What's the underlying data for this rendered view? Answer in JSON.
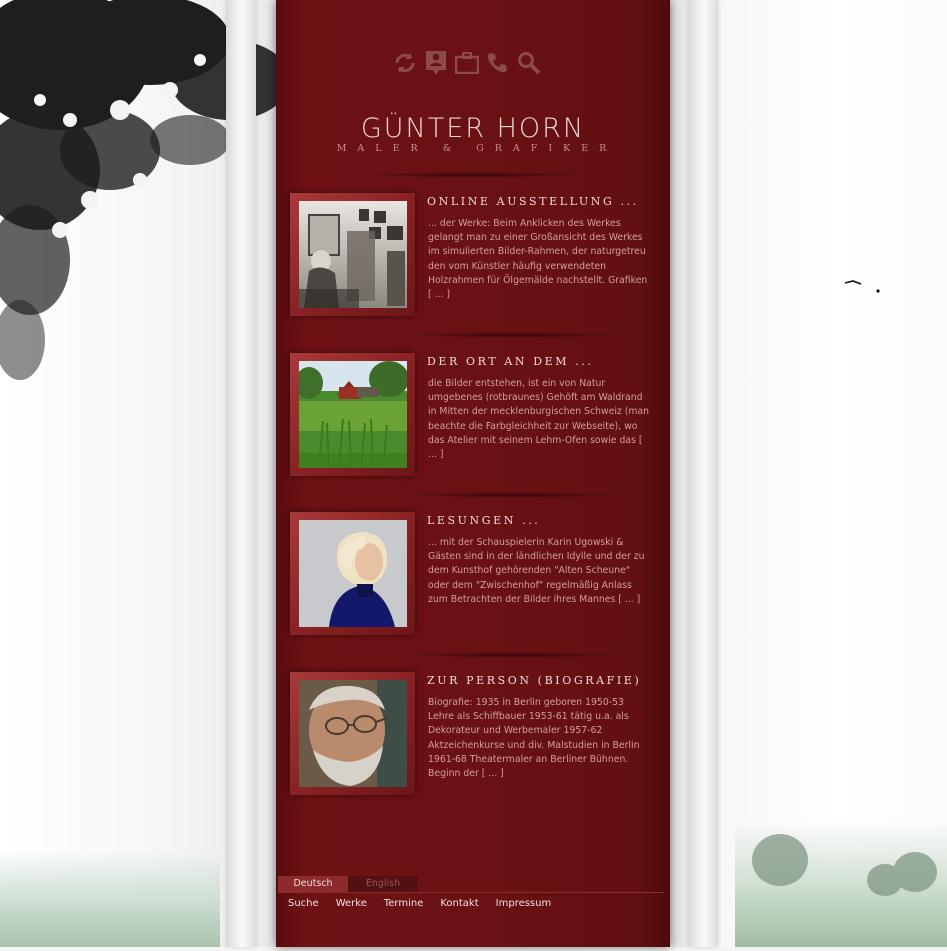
{
  "site": {
    "title": "GÜNTER HORN",
    "subtitle": "MALER & GRAFIKER"
  },
  "toolbar": {
    "icons": [
      "refresh-icon",
      "contact-card-icon",
      "portfolio-icon",
      "phone-icon",
      "search-icon"
    ]
  },
  "articles": [
    {
      "title": "ONLINE AUSSTELLUNG ...",
      "text": "... der Werke: Beim Anklicken des Werkes gelangt man zu einer Großansicht des Werkes im simulierten Bilder-Rahmen, der naturgetreu den vom Künstler häufig verwendeten Holzrahmen für Ölgemälde nachstellt. Grafiken [ ... ]",
      "image": "studio-photo"
    },
    {
      "title": "DER ORT AN DEM ...",
      "text": "die Bilder entstehen, ist ein von Natur umgebenes (rotbraunes) Gehöft am Waldrand in Mitten der mecklenburgischen Schweiz (man beachte die Farbgleichheit zur Webseite), wo das Atelier mit seinem Lehm-Ofen sowie das [ ... ]",
      "image": "farmhouse-photo"
    },
    {
      "title": "LESUNGEN ...",
      "text": "... mit der Schauspielerin Karin Ugowski & Gästen sind in der ländlichen Idylle und der zu dem Kunsthof gehörenden \"Alten Scheune\" oder dem \"Zwischenhof\" regelmäßig Anlass zum Betrachten der Bilder ihres Mannes [ ... ]",
      "image": "woman-portrait-photo"
    },
    {
      "title": "ZUR PERSON (BIOGRAFIE)",
      "text": "Biografie: 1935 in Berlin geboren 1950-53 Lehre als Schiffbauer 1953-61 tätig u.a. als Dekorateur und Werbemaler 1957-62 Aktzeichenkurse und div. Malstudien in Berlin 1961-68 Theatermaler an Berliner Bühnen. Beginn der [ ... ]",
      "image": "man-portrait-photo"
    }
  ],
  "languages": {
    "active": "Deutsch",
    "inactive": "English"
  },
  "footer_nav": [
    "Suche",
    "Werke",
    "Termine",
    "Kontakt",
    "Impressum"
  ],
  "colors": {
    "panel": "#6a1113",
    "frame": "#8a2224",
    "title_text": "#e9d6d3",
    "body_text": "#d29f99"
  }
}
